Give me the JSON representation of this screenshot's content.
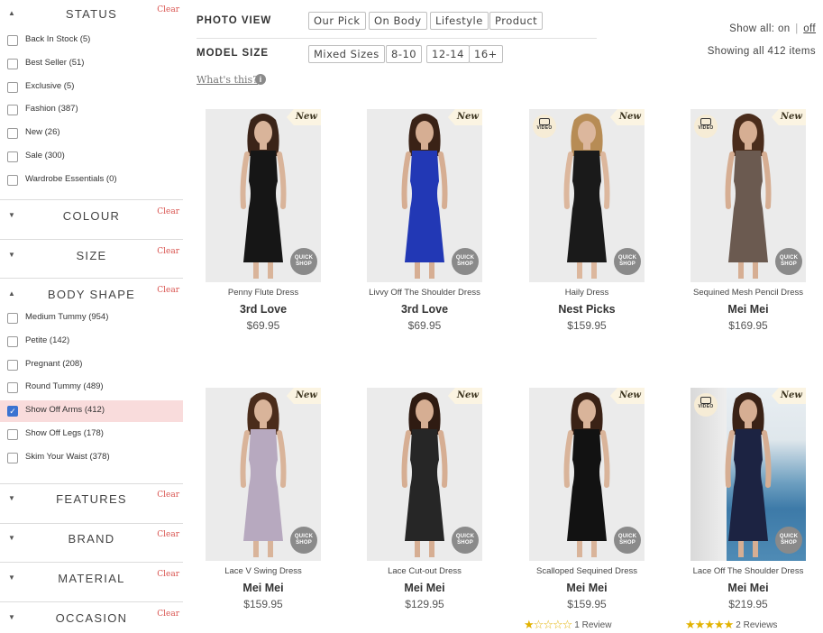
{
  "sidebar": {
    "status": {
      "title": "STATUS",
      "clear": "Clear",
      "arrow": "▲",
      "options": [
        {
          "label": "Back In Stock (5)"
        },
        {
          "label": "Best Seller (51)"
        },
        {
          "label": "Exclusive (5)"
        },
        {
          "label": "Fashion (387)"
        },
        {
          "label": "New (26)"
        },
        {
          "label": "Sale (300)"
        },
        {
          "label": "Wardrobe Essentials (0)"
        }
      ]
    },
    "colour": {
      "title": "COLOUR",
      "clear": "Clear",
      "arrow": "▼"
    },
    "size": {
      "title": "SIZE",
      "clear": "Clear",
      "arrow": "▼"
    },
    "body_shape": {
      "title": "BODY SHAPE",
      "clear": "Clear",
      "arrow": "▲",
      "options": [
        {
          "label": "Medium Tummy (954)",
          "checked": false
        },
        {
          "label": "Petite (142)",
          "checked": false
        },
        {
          "label": "Pregnant (208)",
          "checked": false
        },
        {
          "label": "Round Tummy (489)",
          "checked": false
        },
        {
          "label": "Show Off Arms (412)",
          "checked": true
        },
        {
          "label": "Show Off Legs (178)",
          "checked": false
        },
        {
          "label": "Skim Your Waist (378)",
          "checked": false
        }
      ]
    },
    "features": {
      "title": "FEATURES",
      "clear": "Clear",
      "arrow": "▼"
    },
    "brand": {
      "title": "BRAND",
      "clear": "Clear",
      "arrow": "▼"
    },
    "material": {
      "title": "MATERIAL",
      "clear": "Clear",
      "arrow": "▼"
    },
    "occasion": {
      "title": "OCCASION",
      "clear": "Clear",
      "arrow": "▼"
    }
  },
  "controls": {
    "photo_view_label": "PHOTO VIEW",
    "photo_view_options": [
      "Our Pick",
      "On Body",
      "Lifestyle",
      "Product"
    ],
    "model_size_label": "MODEL SIZE",
    "model_size_options": [
      "Mixed Sizes",
      "8-10",
      "12-14",
      "16+"
    ],
    "whats_this": "What's this?",
    "info_glyph": "i",
    "show_all_label": "Show all:",
    "show_all_on": "on",
    "show_all_sep": "|",
    "show_all_off": "off",
    "showing_text": "Showing all 412 items"
  },
  "badges": {
    "new": "New",
    "video": "VIDEO",
    "quick_line1": "QUICK",
    "quick_line2": "SHOP"
  },
  "products": [
    {
      "name": "Penny Flute Dress",
      "brand": "3rd Love",
      "price": "$69.95",
      "new": true,
      "video": false,
      "dress_color": "#161616",
      "skin": "#d9b49a",
      "hair": "#3b2418"
    },
    {
      "name": "Livvy Off The Shoulder Dress",
      "brand": "3rd Love",
      "price": "$69.95",
      "new": true,
      "video": false,
      "dress_color": "#2238b5",
      "skin": "#d6ae93",
      "hair": "#3a2216"
    },
    {
      "name": "Haily Dress",
      "brand": "Nest Picks",
      "price": "$159.95",
      "new": true,
      "video": true,
      "dress_color": "#1a1a1a",
      "skin": "#dcb79d",
      "hair": "#b78c55"
    },
    {
      "name": "Sequined Mesh Pencil Dress",
      "brand": "Mei Mei",
      "price": "$169.95",
      "new": true,
      "video": true,
      "dress_color": "#6b5a50",
      "skin": "#d6ae93",
      "hair": "#4a2c1b"
    },
    {
      "name": "Lace V Swing Dress",
      "brand": "Mei Mei",
      "price": "$159.95",
      "new": true,
      "video": false,
      "dress_color": "#b7a9bf",
      "skin": "#d9b49a",
      "hair": "#4a2c1b"
    },
    {
      "name": "Lace Cut-out Dress",
      "brand": "Mei Mei",
      "price": "$129.95",
      "new": true,
      "video": false,
      "dress_color": "#262626",
      "skin": "#d6ae93",
      "hair": "#2f1b12"
    },
    {
      "name": "Scalloped Sequined Dress",
      "brand": "Mei Mei",
      "price": "$159.95",
      "new": true,
      "video": false,
      "dress_color": "#121212",
      "skin": "#d9b49a",
      "hair": "#3a2216",
      "rating": 1,
      "reviews": "1 Review"
    },
    {
      "name": "Lace Off The Shoulder Dress",
      "brand": "Mei Mei",
      "price": "$219.95",
      "new": true,
      "video": true,
      "dress_color": "#1c2342",
      "skin": "#d6ae93",
      "hair": "#3a2216",
      "rating": 5,
      "reviews": "2 Reviews",
      "sea": true
    }
  ],
  "colors": {
    "clear": "#d9534f",
    "checked_bg": "#f9dcdc",
    "checkbox_checked": "#3b73d1",
    "star": "#e2b200",
    "new_tag_bg": "#fbf4e2"
  }
}
